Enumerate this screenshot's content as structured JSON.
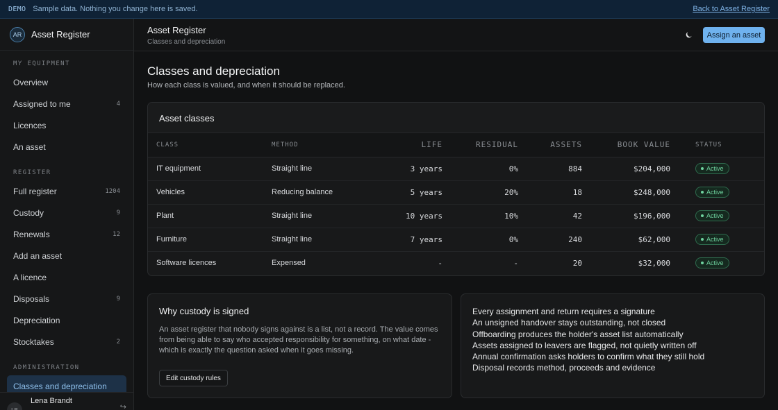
{
  "banner": {
    "tag": "DEMO",
    "message": "Sample data. Nothing you change here is saved.",
    "back_link": "Back to Asset Register"
  },
  "brand": {
    "initials": "AR",
    "name": "Asset Register"
  },
  "sidebar": {
    "sections": [
      {
        "label": "MY EQUIPMENT",
        "items": [
          {
            "label": "Overview",
            "count": ""
          },
          {
            "label": "Assigned to me",
            "count": "4"
          },
          {
            "label": "Licences",
            "count": ""
          },
          {
            "label": "An asset",
            "count": ""
          }
        ]
      },
      {
        "label": "REGISTER",
        "items": [
          {
            "label": "Full register",
            "count": "1204"
          },
          {
            "label": "Custody",
            "count": "9"
          },
          {
            "label": "Renewals",
            "count": "12"
          },
          {
            "label": "Add an asset",
            "count": ""
          },
          {
            "label": "A licence",
            "count": ""
          },
          {
            "label": "Disposals",
            "count": "9"
          },
          {
            "label": "Depreciation",
            "count": ""
          },
          {
            "label": "Stocktakes",
            "count": "2"
          }
        ]
      },
      {
        "label": "ADMINISTRATION",
        "items": [
          {
            "label": "Classes and depreciation",
            "count": "",
            "active": true
          }
        ]
      }
    ],
    "user": {
      "initials": "LB",
      "name": "Lena Brandt",
      "signout_icon": "signout-icon"
    }
  },
  "topbar": {
    "title": "Asset Register",
    "subtitle": "Classes and depreciation",
    "theme_icon": "moon-icon",
    "assign_button": "Assign an asset"
  },
  "page": {
    "title": "Classes and depreciation",
    "subtitle": "How each class is valued, and when it should be replaced."
  },
  "classes": {
    "title": "Asset classes",
    "columns": [
      "CLASS",
      "METHOD",
      "LIFE",
      "RESIDUAL",
      "ASSETS",
      "BOOK VALUE",
      "STATUS"
    ],
    "rows": [
      {
        "class": "IT equipment",
        "method": "Straight line",
        "life": "3 years",
        "residual": "0%",
        "assets": "884",
        "book_value": "$204,000",
        "status": "Active"
      },
      {
        "class": "Vehicles",
        "method": "Reducing balance",
        "life": "5 years",
        "residual": "20%",
        "assets": "18",
        "book_value": "$248,000",
        "status": "Active"
      },
      {
        "class": "Plant",
        "method": "Straight line",
        "life": "10 years",
        "residual": "10%",
        "assets": "42",
        "book_value": "$196,000",
        "status": "Active"
      },
      {
        "class": "Furniture",
        "method": "Straight line",
        "life": "7 years",
        "residual": "0%",
        "assets": "240",
        "book_value": "$62,000",
        "status": "Active"
      },
      {
        "class": "Software licences",
        "method": "Expensed",
        "life": "-",
        "residual": "-",
        "assets": "20",
        "book_value": "$32,000",
        "status": "Active"
      }
    ],
    "status_color": "#6fd39f"
  },
  "why": {
    "title": "Why custody is signed",
    "body": "An asset register that nobody signs against is a list, not a record. The value comes from being able to say who accepted responsibility for something, on what date - which is exactly the question asked when it goes missing.",
    "button": "Edit custody rules"
  },
  "points": [
    "Every assignment and return requires a signature",
    "An unsigned handover stays outstanding, not closed",
    "Offboarding produces the holder's asset list automatically",
    "Assets assigned to leavers are flagged, not quietly written off",
    "Annual confirmation asks holders to confirm what they still hold",
    "Disposal records method, proceeds and evidence"
  ],
  "colors": {
    "accent": "#6fb2ee",
    "background": "#111213"
  }
}
